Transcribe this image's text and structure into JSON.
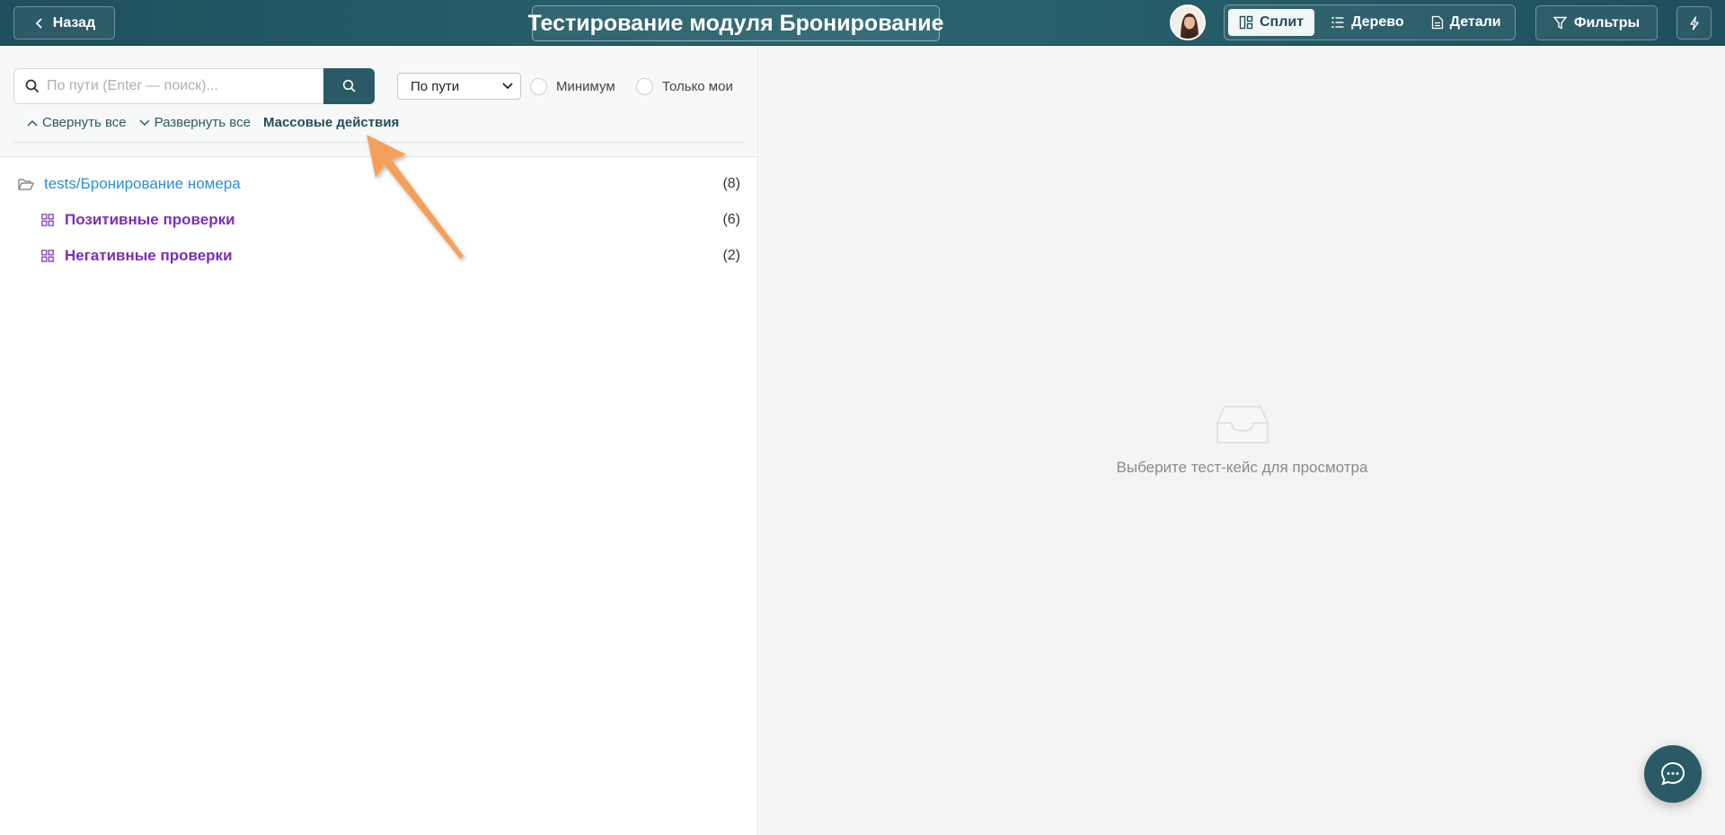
{
  "header": {
    "back_label": "Назад",
    "title": "Тестирование модуля Бронирование",
    "views": [
      {
        "label": "Сплит",
        "icon": "split-icon",
        "active": true
      },
      {
        "label": "Дерево",
        "icon": "list-icon",
        "active": false
      },
      {
        "label": "Детали",
        "icon": "document-icon",
        "active": false
      }
    ],
    "filters_label": "Фильтры",
    "bolt_icon": "bolt-icon"
  },
  "toolbar": {
    "search_placeholder": "По пути (Enter — поиск)...",
    "search_value": "",
    "sort_select": "По пути",
    "minimum_label": "Минимум",
    "only_mine_label": "Только мои",
    "collapse_all": "Свернуть все",
    "expand_all": "Развернуть все",
    "bulk_actions": "Массовые действия"
  },
  "tree": {
    "root": {
      "label": "tests/Бронирование номера",
      "count": "(8)",
      "icon": "folder-open-icon"
    },
    "children": [
      {
        "label": "Позитивные проверки",
        "count": "(6)",
        "icon": "grid-icon"
      },
      {
        "label": "Негативные проверки",
        "count": "(2)",
        "icon": "grid-icon"
      }
    ]
  },
  "detail": {
    "empty_text": "Выберите тест-кейс для просмотра",
    "empty_icon": "inbox-icon"
  },
  "colors": {
    "header_bg": "#2a6470",
    "accent": "#2a5a66",
    "folder_link": "#2b8fd6",
    "suite_label": "#7a2fb5",
    "annotation_arrow": "#f5a05a"
  }
}
